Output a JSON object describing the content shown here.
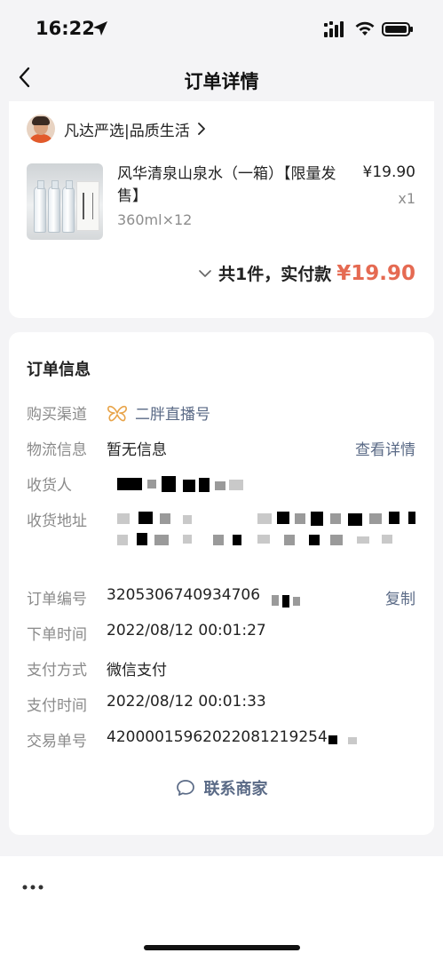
{
  "status": {
    "time": "16:22"
  },
  "nav": {
    "title": "订单详情"
  },
  "shop": {
    "name": "凡达严选|品质生活"
  },
  "product": {
    "title": "风华清泉山泉水（一箱）【限量发售】",
    "spec": "360ml×12",
    "price": "¥19.90",
    "qty": "x1"
  },
  "summary": {
    "text": "共1件，实付款",
    "amount": "¥19.90"
  },
  "info": {
    "title": "订单信息",
    "rows": [
      {
        "label": "购买渠道",
        "value": "二胖直播号"
      },
      {
        "label": "物流信息",
        "value": "暂无信息",
        "action": "查看详情"
      },
      {
        "label": "收货人",
        "value": ""
      },
      {
        "label": "收货地址",
        "value": ""
      },
      {
        "label": "订单编号",
        "value": "3205306740934706",
        "action": "复制"
      },
      {
        "label": "下单时间",
        "value": "2022/08/12 00:01:27"
      },
      {
        "label": "支付方式",
        "value": "微信支付"
      },
      {
        "label": "支付时间",
        "value": "2022/08/12 00:01:33"
      },
      {
        "label": "交易单号",
        "value": "42000015962022081219254"
      }
    ],
    "contact": "联系商家"
  },
  "colors": {
    "accent": "#e56a52",
    "link": "#5a6a86",
    "channel_icon": "#e8a44a"
  }
}
